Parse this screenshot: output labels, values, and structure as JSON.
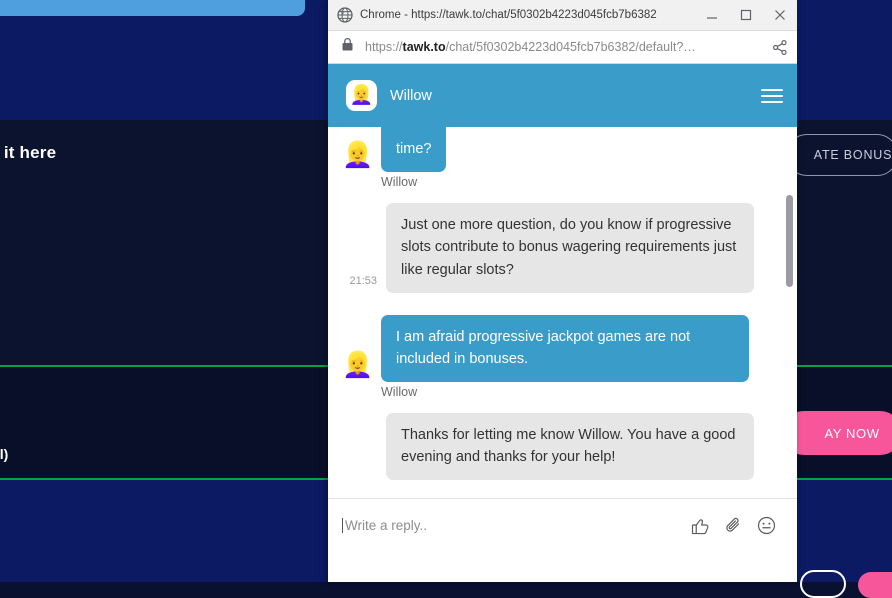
{
  "background_page": {
    "headline_partial": "nter it here",
    "paren_partial": "al)",
    "bonus_button_partial": "ATE BONUS",
    "play_button_partial": "AY NOW",
    "colors": {
      "navy_band": "#0b1a63",
      "dark_band": "#0c132e",
      "darker_band": "#090f28",
      "green_rule": "#00a44a",
      "pink_button": "#f8569b",
      "blue_pill": "#4f9ede"
    }
  },
  "window": {
    "titlebar": {
      "favicon": "globe-icon",
      "title": "Chrome - https://tawk.to/chat/5f0302b4223d045fcb7b6382",
      "minimize_label": "minimize-icon",
      "maximize_label": "maximize-icon",
      "close_label": "close-icon"
    },
    "omnibox": {
      "lock_icon": "lock-icon",
      "url_scheme": "https://",
      "url_host": "tawk.to",
      "url_path": "/chat/5f0302b4223d045fcb7b6382/default?…",
      "share_icon": "share-icon"
    }
  },
  "chat": {
    "header": {
      "avatar": "👱‍♀️",
      "agent_name": "Willow",
      "menu_icon": "hamburger-menu-icon",
      "accent_color": "#3a9cc8"
    },
    "messages": [
      {
        "side": "agent",
        "avatar": "👱‍♀️",
        "text": "time?",
        "sender": "Willow",
        "time": "",
        "clipped": true
      },
      {
        "side": "visitor",
        "avatar": "",
        "text": "Just one more question, do you know if progressive slots contribute to bonus wagering requirements just like regular slots?",
        "sender": "",
        "time": "21:53",
        "clipped": false
      },
      {
        "side": "agent",
        "avatar": "👱‍♀️",
        "text": "I am afraid progressive jackpot games are not included in bonuses.",
        "sender": "Willow",
        "time": "",
        "clipped": false
      },
      {
        "side": "visitor",
        "avatar": "",
        "text": "Thanks for letting me know Willow. You have a good evening and thanks for your help!",
        "sender": "",
        "time": "",
        "clipped": false
      }
    ],
    "composer": {
      "placeholder": "Write a reply..",
      "value": "",
      "like_icon": "thumbs-up-icon",
      "attach_icon": "paperclip-icon",
      "emoji_icon": "emoji-smiley-icon"
    },
    "scrollbar": "chat-scrollbar"
  }
}
